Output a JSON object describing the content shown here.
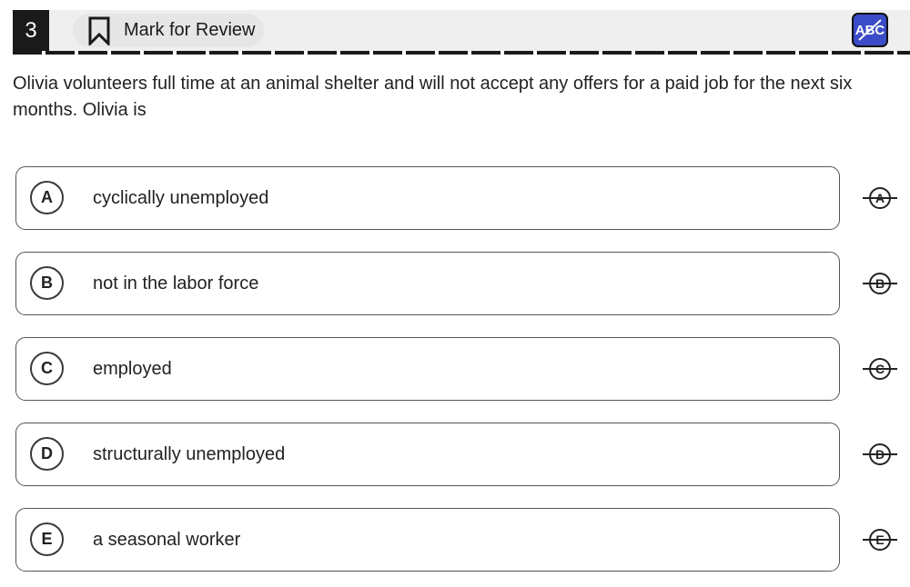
{
  "header": {
    "question_number": "3",
    "mark_for_review_label": "Mark for Review",
    "abc_label": "ABC",
    "accent_color": "#3a4cc7"
  },
  "question": {
    "text": "Olivia volunteers full time at an animal shelter and will not accept any offers for a paid job for the next six months. Olivia is"
  },
  "choices": [
    {
      "letter": "A",
      "text": "cyclically unemployed"
    },
    {
      "letter": "B",
      "text": "not in the labor force"
    },
    {
      "letter": "C",
      "text": "employed"
    },
    {
      "letter": "D",
      "text": "structurally unemployed"
    },
    {
      "letter": "E",
      "text": "a seasonal worker"
    }
  ]
}
